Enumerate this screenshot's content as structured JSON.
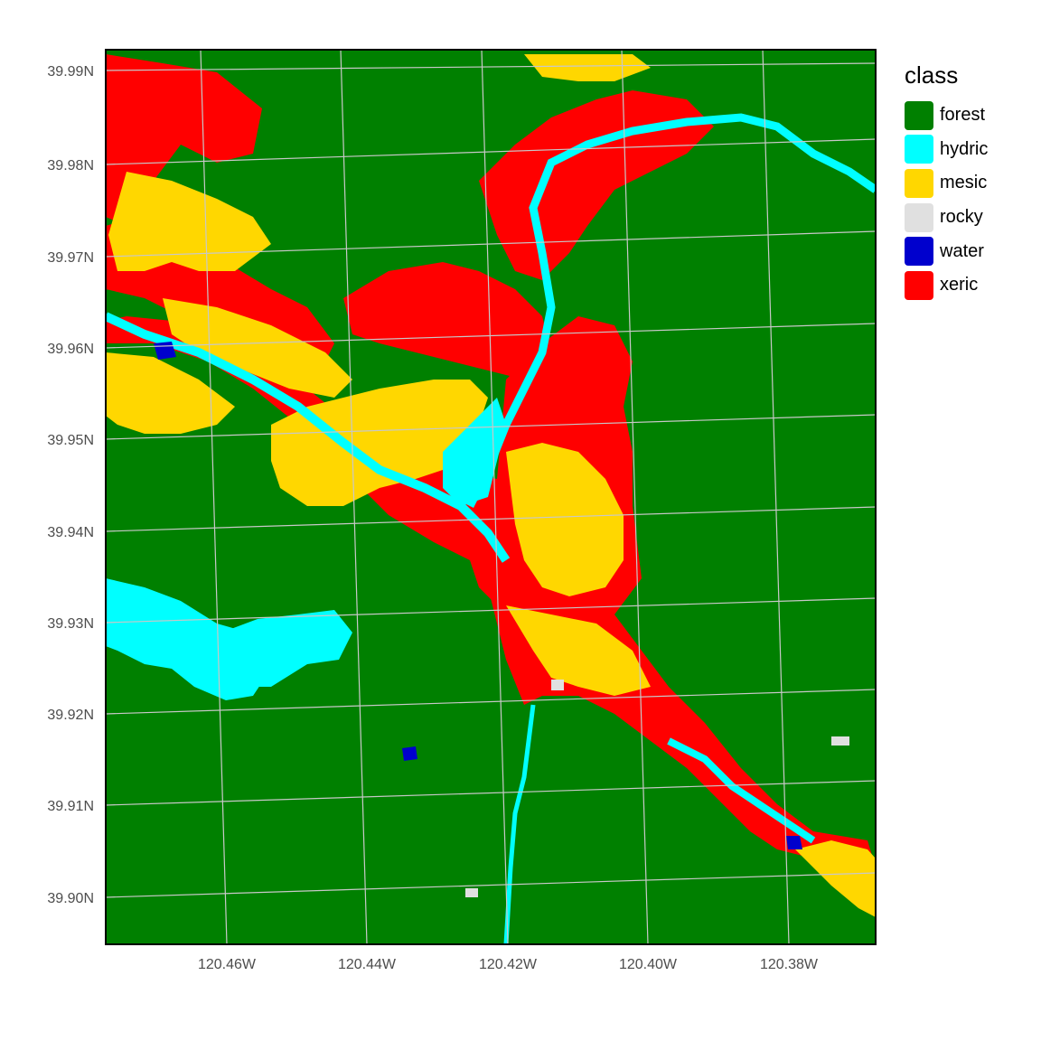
{
  "legend": {
    "title": "class",
    "items": [
      {
        "label": "forest",
        "color": "#008000"
      },
      {
        "label": "hydric",
        "color": "#00FFFF"
      },
      {
        "label": "mesic",
        "color": "#FFD700"
      },
      {
        "label": "rocky",
        "color": "#E0E0E0"
      },
      {
        "label": "water",
        "color": "#0000CD"
      },
      {
        "label": "xeric",
        "color": "#FF0000"
      }
    ]
  },
  "axes": {
    "x_ticks": [
      "120.46W",
      "120.44W",
      "120.42W",
      "120.40W",
      "120.38W"
    ],
    "y_ticks": [
      "39.99N",
      "39.98N",
      "39.97N",
      "39.96N",
      "39.95N",
      "39.94N",
      "39.93N",
      "39.92N",
      "39.91N",
      "39.90N"
    ],
    "grid_color": "#c8c8c8",
    "frame_color": "#000000"
  },
  "map": {
    "base_class": "forest"
  }
}
